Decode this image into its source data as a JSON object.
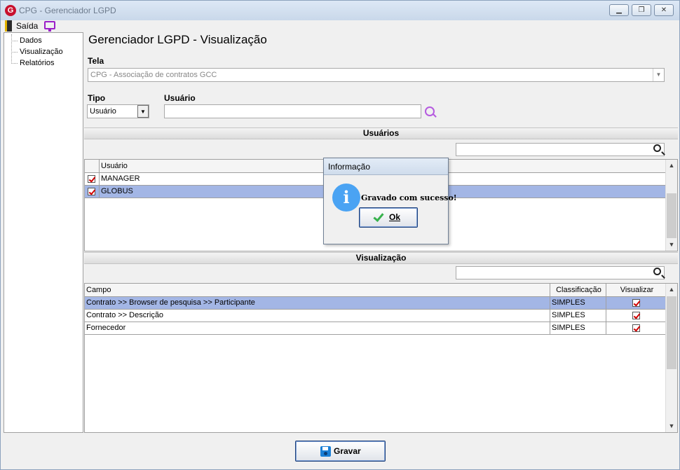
{
  "window": {
    "title": "CPG - Gerenciador LGPD",
    "app_icon_letter": "G",
    "minimize_glyph": "▁",
    "restore_glyph": "❐",
    "close_glyph": "✕"
  },
  "menu": {
    "exit_label": "Saída"
  },
  "tree": {
    "items": [
      "Dados",
      "Visualização",
      "Relatórios"
    ]
  },
  "page": {
    "title": "Gerenciador LGPD - Visualização"
  },
  "form": {
    "tela_label": "Tela",
    "tela_value": "CPG - Associação de contratos GCC",
    "tipo_label": "Tipo",
    "tipo_value": "Usuário",
    "usuario_label": "Usuário",
    "usuario_value": ""
  },
  "usuarios": {
    "section_title": "Usuários",
    "search_value": "",
    "column": "Usuário",
    "rows": [
      {
        "name": "MANAGER",
        "checked": true,
        "selected": false
      },
      {
        "name": "GLOBUS",
        "checked": true,
        "selected": true
      }
    ]
  },
  "visualizacao": {
    "section_title": "Visualização",
    "search_value": "",
    "columns": [
      "Campo",
      "Classificação",
      "Visualizar"
    ],
    "rows": [
      {
        "campo": "Contrato >> Browser de pesquisa >> Participante",
        "classificacao": "SIMPLES",
        "visualizar": true,
        "selected": true
      },
      {
        "campo": "Contrato >> Descrição",
        "classificacao": "SIMPLES",
        "visualizar": true,
        "selected": false
      },
      {
        "campo": "Fornecedor",
        "classificacao": "SIMPLES",
        "visualizar": true,
        "selected": false
      }
    ]
  },
  "dialog": {
    "title": "Informação",
    "icon_glyph": "i",
    "message": "Gravado com sucesso!",
    "ok_label": "Ok"
  },
  "footer": {
    "save_label": "Gravar"
  },
  "glyphs": {
    "dropdown": "▼",
    "scroll_up": "▲",
    "scroll_down": "▼"
  },
  "colors": {
    "selection": "#a3b6e5",
    "check": "#d10000",
    "info": "#4aa3f3",
    "save": "#1a7fd6"
  }
}
